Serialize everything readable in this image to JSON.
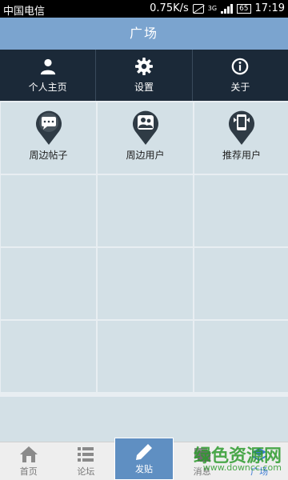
{
  "status_bar": {
    "carrier": "中国电信",
    "speed": "0.75K/s",
    "network": "3G",
    "battery": "65",
    "time": "17:19"
  },
  "header": {
    "title": "广场"
  },
  "top_menu": [
    {
      "label": "个人主页",
      "icon": "user-icon"
    },
    {
      "label": "设置",
      "icon": "gear-icon"
    },
    {
      "label": "关于",
      "icon": "info-icon"
    }
  ],
  "grid_items": [
    {
      "label": "周边帖子",
      "icon": "chat-pin-icon"
    },
    {
      "label": "周边用户",
      "icon": "users-pin-icon"
    },
    {
      "label": "推荐用户",
      "icon": "recommend-pin-icon"
    }
  ],
  "bottom_nav": [
    {
      "label": "首页",
      "icon": "home-icon"
    },
    {
      "label": "论坛",
      "icon": "list-icon"
    },
    {
      "label": "发贴",
      "icon": "pencil-icon"
    },
    {
      "label": "消息",
      "icon": "message-icon"
    },
    {
      "label": "广场",
      "icon": "square-icon"
    }
  ],
  "watermark": {
    "text": "绿色资源网",
    "url": "www.downcc.com"
  },
  "colors": {
    "title_bar": "#7ba4cf",
    "menu_bg": "#1b2938",
    "grid_cell": "#d3e0e6",
    "post_button": "#5f8fc2",
    "pin": "#2f3b45"
  }
}
